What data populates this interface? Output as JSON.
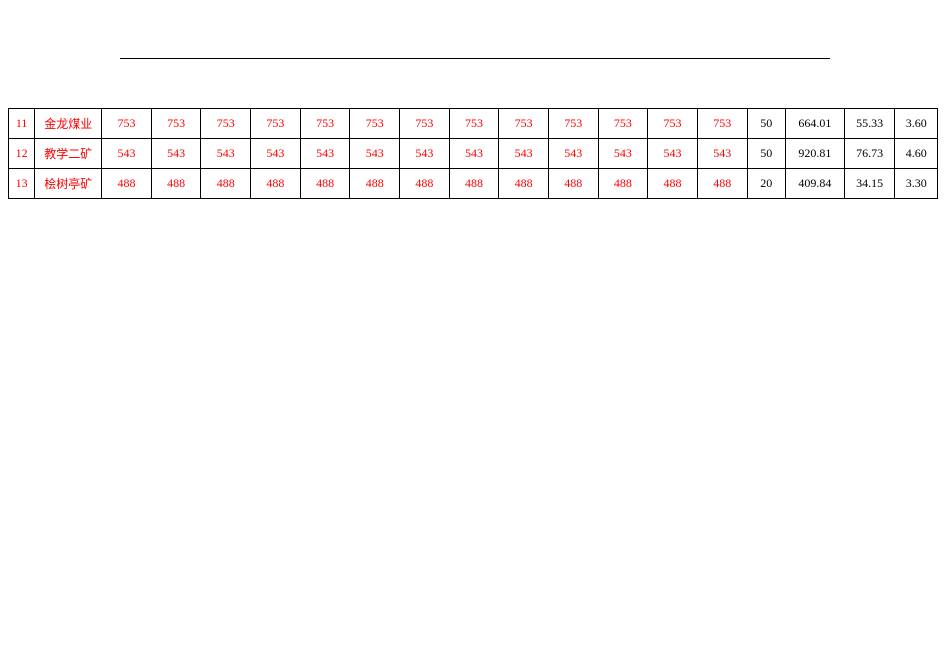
{
  "rows": [
    {
      "idx": "11",
      "name": "金龙煤业",
      "vals": [
        "753",
        "753",
        "753",
        "753",
        "753",
        "753",
        "753",
        "753",
        "753",
        "753",
        "753",
        "753",
        "753"
      ],
      "tail": [
        "50",
        "664.01",
        "55.33",
        "3.60"
      ]
    },
    {
      "idx": "12",
      "name": "教学二矿",
      "vals": [
        "543",
        "543",
        "543",
        "543",
        "543",
        "543",
        "543",
        "543",
        "543",
        "543",
        "543",
        "543",
        "543"
      ],
      "tail": [
        "50",
        "920.81",
        "76.73",
        "4.60"
      ]
    },
    {
      "idx": "13",
      "name": "桧树亭矿",
      "vals": [
        "488",
        "488",
        "488",
        "488",
        "488",
        "488",
        "488",
        "488",
        "488",
        "488",
        "488",
        "488",
        "488"
      ],
      "tail": [
        "20",
        "409.84",
        "34.15",
        "3.30"
      ]
    }
  ]
}
